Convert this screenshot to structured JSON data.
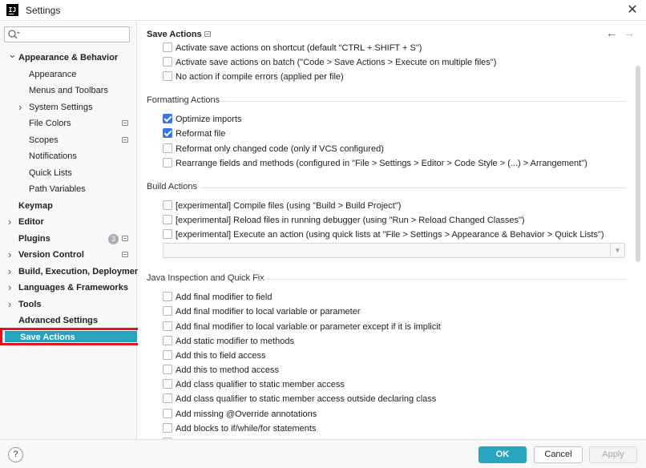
{
  "window": {
    "title": "Settings",
    "app_icon": "intellij-icon",
    "close_icon": "close-icon"
  },
  "sidebar": {
    "search": {
      "value": "",
      "placeholder": ""
    },
    "items": [
      {
        "label": "Appearance & Behavior",
        "level": 0,
        "bold": true,
        "expanded": true
      },
      {
        "label": "Appearance",
        "level": 1
      },
      {
        "label": "Menus and Toolbars",
        "level": 1
      },
      {
        "label": "System Settings",
        "level": 1,
        "collapsed": true
      },
      {
        "label": "File Colors",
        "level": 1,
        "gear": true
      },
      {
        "label": "Scopes",
        "level": 1,
        "gear": true
      },
      {
        "label": "Notifications",
        "level": 1
      },
      {
        "label": "Quick Lists",
        "level": 1
      },
      {
        "label": "Path Variables",
        "level": 1
      },
      {
        "label": "Keymap",
        "level": 0,
        "bold": true
      },
      {
        "label": "Editor",
        "level": 0,
        "bold": true,
        "collapsed": true
      },
      {
        "label": "Plugins",
        "level": 0,
        "bold": true,
        "badge": "3",
        "gear": true
      },
      {
        "label": "Version Control",
        "level": 0,
        "bold": true,
        "collapsed": true,
        "gear": true
      },
      {
        "label": "Build, Execution, Deployment",
        "level": 0,
        "bold": true,
        "collapsed": true
      },
      {
        "label": "Languages & Frameworks",
        "level": 0,
        "bold": true,
        "collapsed": true
      },
      {
        "label": "Tools",
        "level": 0,
        "bold": true,
        "collapsed": true
      },
      {
        "label": "Advanced Settings",
        "level": 0,
        "bold": true
      }
    ],
    "selected": {
      "label": "Save Actions"
    }
  },
  "main": {
    "breadcrumb": "Save Actions",
    "nav": {
      "back": "←",
      "forward": "→"
    },
    "top_options": [
      {
        "label": "Activate save actions on shortcut (default \"CTRL + SHIFT + S\")",
        "checked": false
      },
      {
        "label": "Activate save actions on batch (\"Code > Save Actions > Execute on multiple files\")",
        "checked": false
      },
      {
        "label": "No action if compile errors (applied per file)",
        "checked": false
      }
    ],
    "formatting": {
      "title": "Formatting Actions",
      "options": [
        {
          "label": "Optimize imports",
          "checked": true
        },
        {
          "label": "Reformat file",
          "checked": true
        },
        {
          "label": "Reformat only changed code (only if VCS configured)",
          "checked": false
        },
        {
          "label": "Rearrange fields and methods (configured in \"File > Settings > Editor > Code Style > (...) > Arrangement\")",
          "checked": false
        }
      ]
    },
    "build": {
      "title": "Build Actions",
      "options": [
        {
          "label": "[experimental] Compile files (using \"Build > Build Project\")",
          "checked": false
        },
        {
          "label": "[experimental] Reload files in running debugger (using \"Run > Reload Changed Classes\")",
          "checked": false
        },
        {
          "label": "[experimental] Execute an action (using quick lists at \"File > Settings > Appearance & Behavior > Quick Lists\")",
          "checked": false
        }
      ],
      "quick_list_value": ""
    },
    "java": {
      "title": "Java Inspection and Quick Fix",
      "options": [
        {
          "label": "Add final modifier to field",
          "checked": false
        },
        {
          "label": "Add final modifier to local variable or parameter",
          "checked": false
        },
        {
          "label": "Add final modifier to local variable or parameter except if it is implicit",
          "checked": false
        },
        {
          "label": "Add static modifier to methods",
          "checked": false
        },
        {
          "label": "Add this to field access",
          "checked": false
        },
        {
          "label": "Add this to method access",
          "checked": false
        },
        {
          "label": "Add class qualifier to static member access",
          "checked": false
        },
        {
          "label": "Add class qualifier to static member access outside declaring class",
          "checked": false
        },
        {
          "label": "Add missing @Override annotations",
          "checked": false
        },
        {
          "label": "Add blocks to if/while/for statements",
          "checked": false
        }
      ]
    }
  },
  "footer": {
    "help": "?",
    "ok": "OK",
    "cancel": "Cancel",
    "apply": "Apply"
  },
  "colors": {
    "accent": "#27a4c0",
    "checkbox": "#3574f0",
    "highlight_border": "#e0141c"
  }
}
